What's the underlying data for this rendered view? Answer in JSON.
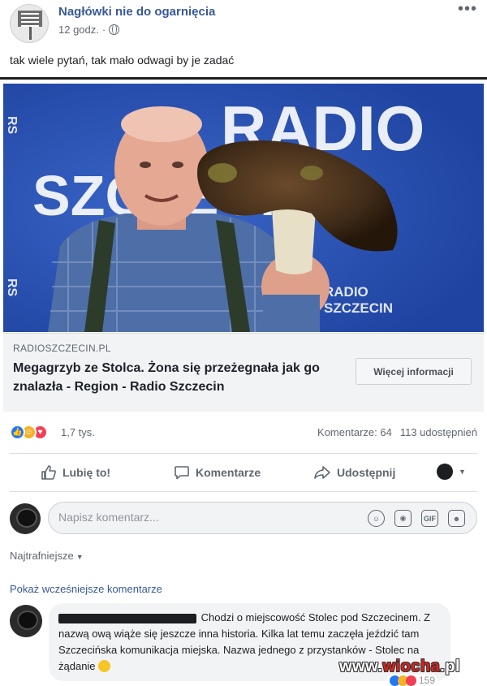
{
  "post": {
    "page_name": "Nagłówki nie do ogarnięcia",
    "time": "12 godz.",
    "more_icon": "more-dots-icon",
    "text": "tak wiele pytań, tak mało odwagi by je zadać"
  },
  "link": {
    "domain": "RADIOSZCZECIN.PL",
    "title": "Megagrzyb ze Stolca. Żona się przeżegnała jak go znalazła - Region - Radio Szczecin",
    "button_label": "Więcej informacji",
    "image_text": {
      "big": "RADIO SZCZECIN",
      "small_top": "RADIO",
      "small_bottom": "SZCZECIN"
    }
  },
  "reactions": {
    "count": "1,7 tys.",
    "comments": "Komentarze: 64",
    "shares": "113 udostępnień",
    "icons": [
      "like-icon",
      "haha-icon",
      "love-icon"
    ]
  },
  "actions": {
    "like": "Lubię to!",
    "comment": "Komentarze",
    "share": "Udostępnij"
  },
  "composer": {
    "placeholder": "Napisz komentarz..."
  },
  "comments": {
    "sort_label": "Najtrafniejsze",
    "show_previous": "Pokaż wcześniejsze komentarze",
    "items": [
      {
        "text": "Chodzi o miejscowość Stolec pod Szczecinem. Z nazwą ową wiąże się jeszcze inna historia. Kilka lat temu zaczęła jeździć tam Szczecińska komunikacja miejska. Nazwa jednego z przystanków - Stolec na żądanie",
        "reactions": "159"
      }
    ]
  },
  "watermark": {
    "part1": "www.",
    "part2": "wiocha",
    "part3": ".pl"
  },
  "colors": {
    "link_blue": "#385898",
    "like_blue": "#2078f4",
    "radio_bg": "#2e56b8"
  }
}
